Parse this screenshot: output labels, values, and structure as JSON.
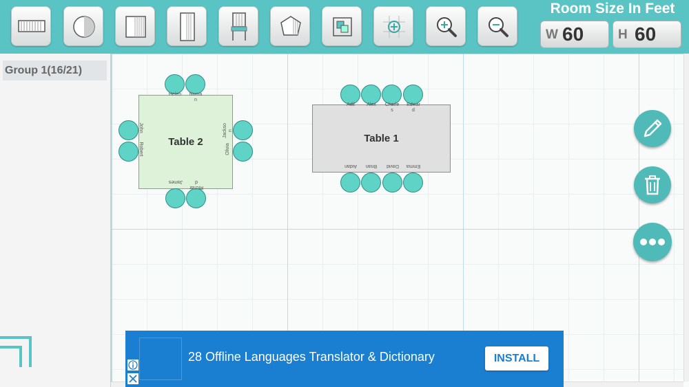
{
  "toolbar": {
    "tools": [
      {
        "name": "rect-table-icon"
      },
      {
        "name": "round-table-icon"
      },
      {
        "name": "square-table-icon"
      },
      {
        "name": "long-table-icon"
      },
      {
        "name": "chair-icon"
      },
      {
        "name": "polygon-icon"
      },
      {
        "name": "select-all-icon"
      },
      {
        "name": "center-view-icon"
      },
      {
        "name": "zoom-in-icon"
      },
      {
        "name": "zoom-out-icon"
      }
    ]
  },
  "room": {
    "title": "Room Size In Feet",
    "width_label": "W",
    "width_value": "60",
    "height_label": "H",
    "height_value": "60"
  },
  "sidebar": {
    "group_label": "Group 1(16/21)"
  },
  "tables": {
    "t2": {
      "label": "Table 2",
      "top": [
        "Helen",
        "Noman"
      ],
      "bottom": [
        "James",
        "Richard"
      ],
      "left": [
        "John",
        "Robert"
      ],
      "right": [
        "Jackson",
        "Olivia"
      ]
    },
    "t1": {
      "label": "Table 1",
      "top": [
        "Adil",
        "Alex",
        "Charles",
        "Edward"
      ],
      "bottom": [
        "Aidan",
        "Brian",
        "David",
        "Emma"
      ]
    }
  },
  "ad": {
    "text": "28 Offline Languages Translator & Dictionary",
    "button": "INSTALL"
  },
  "colors": {
    "accent": "#5ac4c4",
    "seat": "#5fd3c6",
    "fab": "#4fbab8",
    "ad": "#1a7ed1"
  }
}
